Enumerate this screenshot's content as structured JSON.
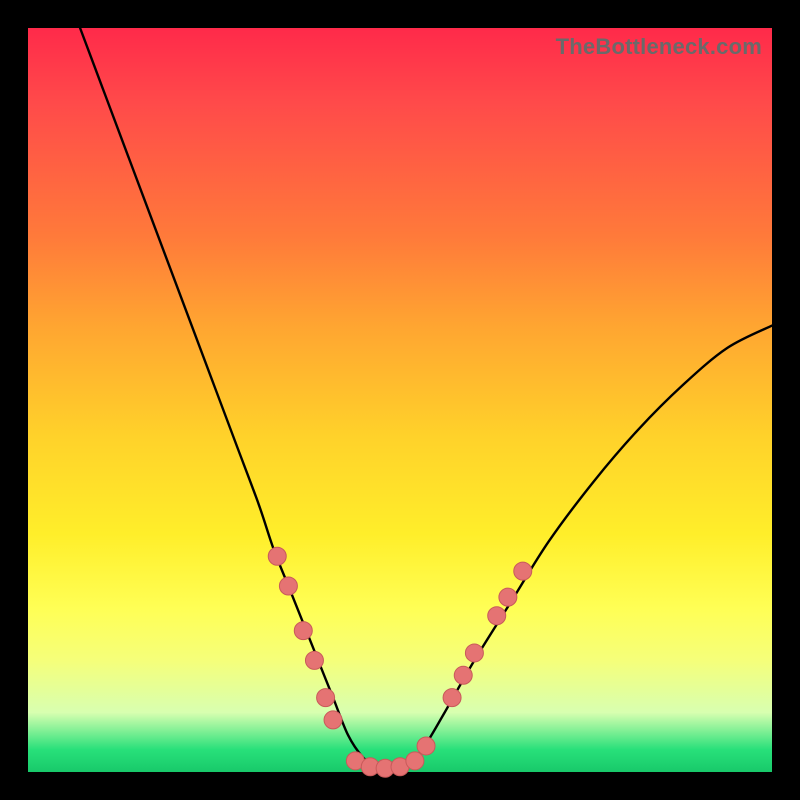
{
  "watermark": "TheBottleneck.com",
  "chart_data": {
    "type": "line",
    "title": "",
    "xlabel": "",
    "ylabel": "",
    "xlim": [
      0,
      100
    ],
    "ylim": [
      0,
      100
    ],
    "curve": {
      "x": [
        7,
        10,
        13,
        16,
        19,
        22,
        25,
        28,
        31,
        33,
        35,
        37,
        39,
        41,
        43,
        45,
        47,
        49,
        51,
        53,
        56,
        60,
        65,
        70,
        76,
        82,
        88,
        94,
        100
      ],
      "y": [
        100,
        92,
        84,
        76,
        68,
        60,
        52,
        44,
        36,
        30,
        25,
        20,
        15,
        10,
        5,
        2,
        0.5,
        0.5,
        1,
        3,
        8,
        15,
        23,
        31,
        39,
        46,
        52,
        57,
        60
      ]
    },
    "markers": [
      {
        "x": 33.5,
        "y": 29
      },
      {
        "x": 35.0,
        "y": 25
      },
      {
        "x": 37.0,
        "y": 19
      },
      {
        "x": 38.5,
        "y": 15
      },
      {
        "x": 40.0,
        "y": 10
      },
      {
        "x": 41.0,
        "y": 7
      },
      {
        "x": 44.0,
        "y": 1.5
      },
      {
        "x": 46.0,
        "y": 0.7
      },
      {
        "x": 48.0,
        "y": 0.5
      },
      {
        "x": 50.0,
        "y": 0.7
      },
      {
        "x": 52.0,
        "y": 1.5
      },
      {
        "x": 53.5,
        "y": 3.5
      },
      {
        "x": 57.0,
        "y": 10
      },
      {
        "x": 58.5,
        "y": 13
      },
      {
        "x": 60.0,
        "y": 16
      },
      {
        "x": 63.0,
        "y": 21
      },
      {
        "x": 64.5,
        "y": 23.5
      },
      {
        "x": 66.5,
        "y": 27
      }
    ]
  }
}
